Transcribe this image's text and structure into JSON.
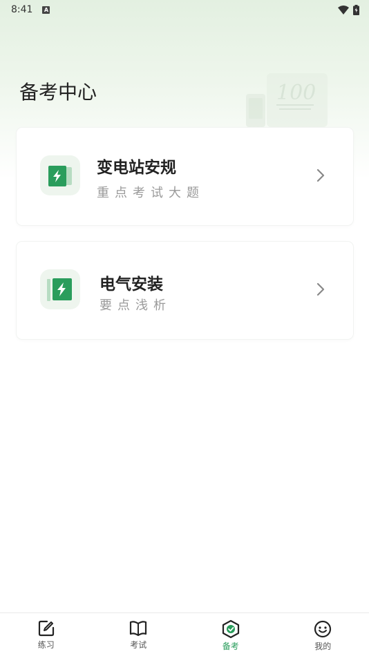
{
  "status_bar": {
    "time": "8:41",
    "notification_icon": "a-icon",
    "wifi_icon": "wifi-icon",
    "battery_icon": "battery-icon"
  },
  "page": {
    "title": "备考中心",
    "decoration_text": "100"
  },
  "cards": [
    {
      "title": "变电站安规",
      "subtitle": "重点考试大题",
      "icon": "lightning-book-icon"
    },
    {
      "title": "电气安装",
      "subtitle": "要点浅析",
      "icon": "lightning-book-icon"
    }
  ],
  "tabbar": {
    "tabs": [
      {
        "label": "练习",
        "icon": "edit-icon",
        "active": false
      },
      {
        "label": "考试",
        "icon": "book-icon",
        "active": false
      },
      {
        "label": "备考",
        "icon": "shield-icon",
        "active": true
      },
      {
        "label": "我的",
        "icon": "smile-icon",
        "active": false
      }
    ]
  },
  "colors": {
    "accent": "#2a9d5c",
    "icon_bg": "#eef5ee"
  }
}
